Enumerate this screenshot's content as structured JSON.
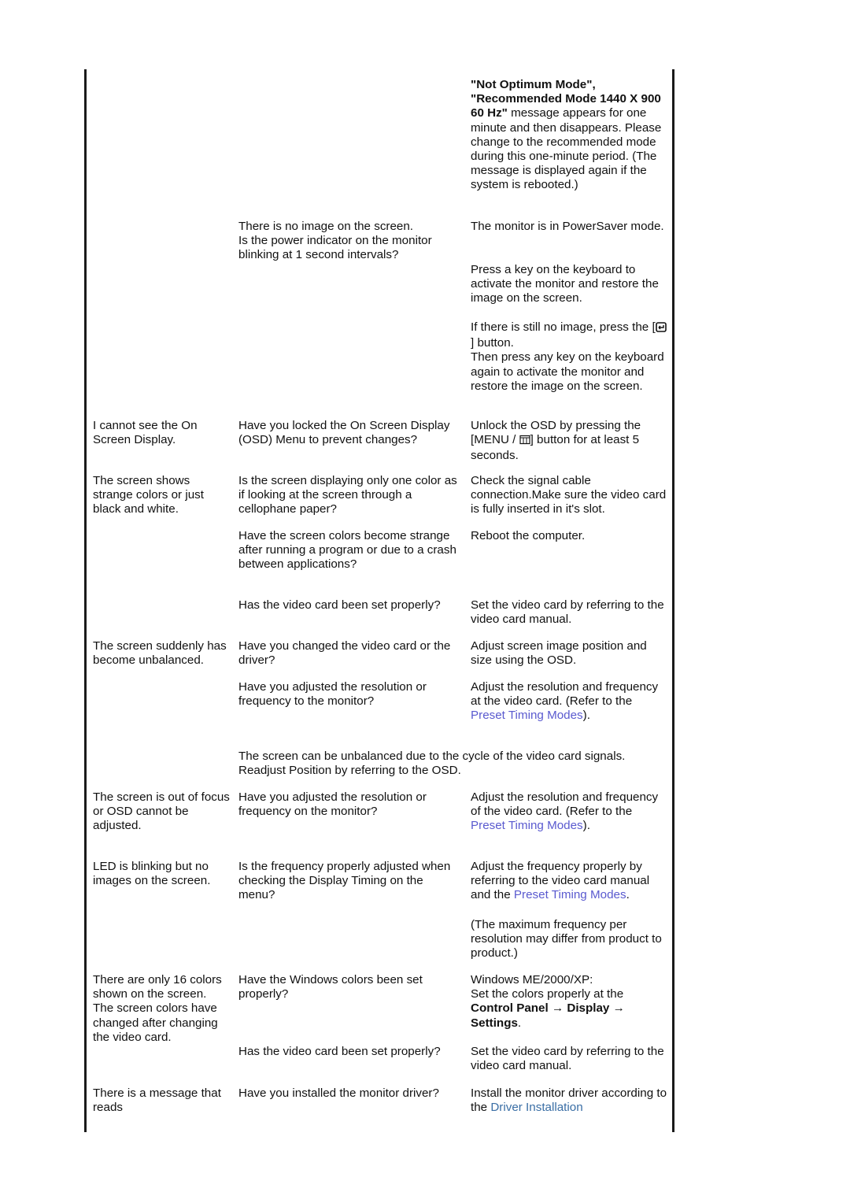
{
  "colors": {
    "link": "#5a5acf",
    "link_driver": "#3a6ea5",
    "text": "#111111",
    "border": "#1a1a1a"
  },
  "rows": {
    "not_optimum": {
      "answer_bold": "\"Not Optimum Mode\", \"Recommended Mode 1440 X 900 60 Hz\"",
      "answer_rest": " message appears for one minute and then disappears. Please change to the recommended mode during this one-minute period. (The message is displayed again if the system is rebooted.)"
    },
    "powersaver": {
      "check": "There is no image on the screen.\nIs the power indicator on the monitor blinking at 1 second intervals?",
      "answer1": "The monitor is in PowerSaver mode.",
      "answer2": "Press a key on the keyboard to activate the monitor and restore the image on the screen.",
      "answer3_pre": "If there is still no image, press the [",
      "answer3_icon": "source-button-icon",
      "answer3_post": "] button.",
      "answer4": "Then press any key on the keyboard again to activate the monitor and restore the image on the screen."
    },
    "osd": {
      "symptom": "I cannot see the On Screen Display.",
      "check": "Have you locked the On Screen Display (OSD) Menu to prevent changes?",
      "answer_pre": "Unlock the OSD by pressing the [MENU / ",
      "answer_icon": "menu-button-icon",
      "answer_post": "] button for at least 5 seconds."
    },
    "strange_colors": {
      "symptom": "The screen shows strange colors or just black and white.",
      "check1": "Is the screen displaying only one color as if looking at the screen through a cellophane paper?",
      "answer1": "Check the signal cable connection.Make sure the video card is fully inserted in it's slot.",
      "check2": "Have the screen colors become strange after running a program or due to a crash between applications?",
      "answer2": "Reboot the computer.",
      "check3": "Has the video card been set properly?",
      "answer3": "Set the video card by referring to the video card manual."
    },
    "unbalanced": {
      "symptom": "The screen suddenly has become unbalanced.",
      "check1": "Have you changed the video card or the driver?",
      "answer1": "Adjust screen image position and size using the OSD.",
      "check2": "Have you adjusted the resolution or frequency to the monitor?",
      "answer2_pre": "Adjust the resolution and frequency at the video card. (Refer to the ",
      "answer2_link": "Preset Timing Modes",
      "answer2_post": ").",
      "note": "The screen can be unbalanced due to the cycle of the video card signals. Readjust Position by referring to the OSD."
    },
    "out_of_focus": {
      "symptom": "The screen is out of focus or OSD cannot be adjusted.",
      "check": "Have you adjusted the resolution or frequency on the monitor?",
      "answer_pre": "Adjust the resolution and frequency of the video card. (Refer to the ",
      "answer_link": "Preset Timing Modes",
      "answer_post": ")."
    },
    "led_blinking": {
      "symptom": "LED is blinking but no images on the screen.",
      "check": "Is the frequency properly adjusted when checking the Display Timing on the menu?",
      "answer_pre": "Adjust the frequency properly by referring to the video card manual and the ",
      "answer_link": "Preset Timing Modes",
      "answer_post": ".",
      "answer2": "(The maximum frequency per resolution may differ from product to product.)"
    },
    "sixteen_colors": {
      "symptom": "There are only 16 colors shown on the screen.\nThe screen colors have changed after changing the video card.",
      "check1": "Have the Windows colors been set properly?",
      "answer1_line1": "Windows ME/2000/XP:",
      "answer1_line2": "Set the colors properly at the ",
      "answer1_bold": "Control Panel → Display → Settings",
      "answer1_end": ".",
      "check2": "Has the video card been set properly?",
      "answer2": "Set the video card by referring to the video card manual."
    },
    "message": {
      "symptom": "There is a message that reads",
      "check": "Have you installed the monitor driver?",
      "answer_pre": "Install the monitor driver according to the ",
      "answer_link": "Driver Installation"
    }
  }
}
